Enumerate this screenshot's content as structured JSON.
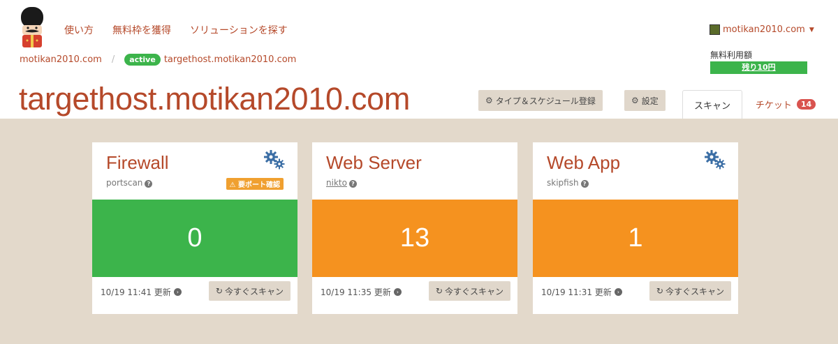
{
  "nav": {
    "items": [
      {
        "label": "使い方"
      },
      {
        "label": "無料枠を獲得"
      },
      {
        "label": "ソリューションを探す"
      }
    ]
  },
  "breadcrumb": {
    "root": "motikan2010.com",
    "status": "active",
    "current": "targethost.motikan2010.com"
  },
  "page": {
    "title": "targethost.motikan2010.com"
  },
  "user": {
    "name": "motikan2010.com"
  },
  "usage": {
    "label": "無料利用額",
    "remaining": "残り10円"
  },
  "toolbar": {
    "schedule_label": "タイプ＆スケジュール登録",
    "settings_label": "設定"
  },
  "tabs": {
    "scan_label": "スキャン",
    "ticket_label": "チケット",
    "ticket_count": "14"
  },
  "cards": [
    {
      "title": "Firewall",
      "tool": "portscan",
      "warning": "⚠ 要ポート確認",
      "count": "0",
      "updated": "10/19 11:41 更新",
      "scan_label": "今すぐスキャン"
    },
    {
      "title": "Web Server",
      "tool": "nikto",
      "count": "13",
      "updated": "10/19 11:35 更新",
      "scan_label": "今すぐスキャン"
    },
    {
      "title": "Web App",
      "tool": "skipfish",
      "count": "1",
      "updated": "10/19 11:31 更新",
      "scan_label": "今すぐスキャン"
    }
  ],
  "colors": {
    "brand": "#b5492a",
    "ok": "#3cb44b",
    "warn": "#f5921f",
    "danger": "#d9534f",
    "background": "#e3d9cb"
  },
  "icons": {
    "logo": "guard-mascot-icon",
    "gear": "gears-icon",
    "help": "question-circle-icon",
    "refresh": "refresh-icon",
    "arrow": "arrow-circle-right-icon"
  }
}
